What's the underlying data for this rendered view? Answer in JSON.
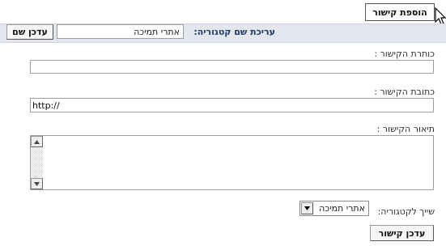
{
  "toolbar": {
    "add_link_label": "הוספת קישור"
  },
  "category_edit": {
    "label": "עריכת שם קטגוריה:",
    "name_value": "אתרי תמיכה",
    "update_label": "עדכן שם"
  },
  "form": {
    "title_label": "כותרת הקישור :",
    "title_value": "",
    "url_label": "כתובת הקישור :",
    "url_value": "http://",
    "description_label": "תיאור הקישור :",
    "description_value": "",
    "assign_label": "שייך לקטגוריה:",
    "assign_selected": "אתרי תמיכה",
    "submit_label": "עדכן קישור"
  },
  "icons": {
    "cursor": "mouse-pointer-icon",
    "scroll_up": "triangle-up-icon",
    "scroll_down": "triangle-down-icon",
    "dropdown": "triangle-down-icon"
  },
  "colors": {
    "band_background": "#e3e6ec",
    "category_label": "#1d3b66"
  }
}
